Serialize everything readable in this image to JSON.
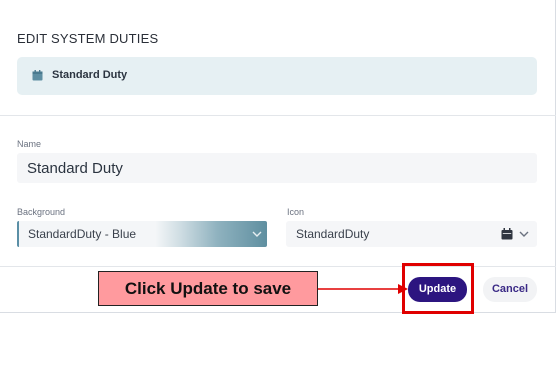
{
  "dialog": {
    "title": "EDIT SYSTEM DUTIES",
    "banner": {
      "icon": "calendar-icon",
      "label": "Standard Duty"
    }
  },
  "form": {
    "name": {
      "label": "Name",
      "value": "Standard Duty"
    },
    "background": {
      "label": "Background",
      "value": "StandardDuty - Blue",
      "icon": "chevron-down-icon"
    },
    "icon": {
      "label": "Icon",
      "value": "StandardDuty",
      "icon": "calendar-icon"
    }
  },
  "actions": {
    "update_label": "Update",
    "cancel_label": "Cancel"
  },
  "annotation": {
    "callout_text": "Click Update to save",
    "highlight_color": "#e00000",
    "callout_color": "#ff9a9e"
  },
  "colors": {
    "primary": "#2c1580",
    "banner_bg": "#e6f0f3",
    "input_bg": "#f5f6f8"
  }
}
